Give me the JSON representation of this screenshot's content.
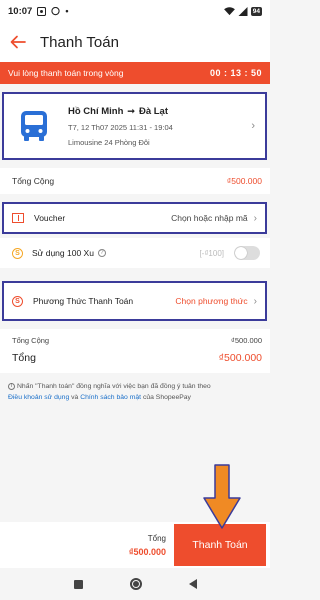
{
  "status_bar": {
    "time": "10:07",
    "battery": "94"
  },
  "header": {
    "title": "Thanh Toán"
  },
  "banner": {
    "message": "Vui lòng thanh toán trong vòng",
    "timer": "00 : 13 : 50"
  },
  "trip": {
    "from": "Hồ Chí Minh",
    "arrow": "➞",
    "to": "Đà Lạt",
    "datetime": "T7, 12 Th07 2025 11:31 - 19:04",
    "vehicle": "Limousine 24 Phòng Đôi"
  },
  "total": {
    "label": "Tổng Cộng",
    "value": "₫500.000"
  },
  "voucher": {
    "label": "Voucher",
    "action": "Chọn hoặc nhập mã"
  },
  "xu": {
    "label": "Sử dụng 100 Xu",
    "value": "[-₫100]"
  },
  "payment_method": {
    "label": "Phương Thức Thanh Toán",
    "action": "Chọn phương thức"
  },
  "summary": {
    "subtotal_label": "Tổng Cộng",
    "subtotal_value": "₫500.000",
    "total_label": "Tổng",
    "total_value": "₫500.000"
  },
  "note": {
    "prefix": "Nhấn \"Thanh toán\" đồng nghĩa với việc bạn đã đồng ý tuân theo",
    "terms_link": "Điều khoản sử dụng",
    "and": "và",
    "privacy_link": "Chính sách bảo mật",
    "suffix": "của ShopeePay"
  },
  "bottom_bar": {
    "total_label": "Tổng",
    "total_value": "₫500.000",
    "pay_button": "Thanh Toán"
  },
  "colors": {
    "accent": "#ee4d2d",
    "highlight_box": "#3b3b9a",
    "annotation_arrow": "#f08a24",
    "link": "#1a6fc9"
  }
}
